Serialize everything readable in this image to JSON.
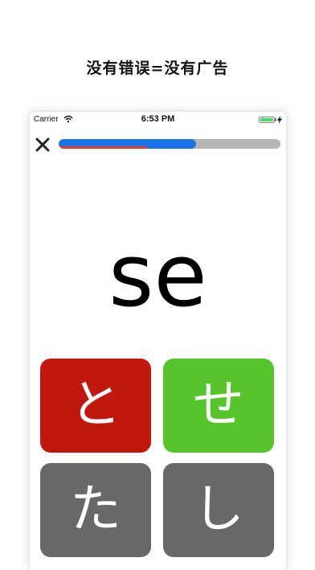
{
  "headline": "没有错误=没有广告",
  "statusbar": {
    "carrier": "Carrier",
    "time": "6:53 PM",
    "battery_color": "#4cd964"
  },
  "quiz": {
    "close_icon": "close-x-icon",
    "progress": {
      "fraction": 0.62,
      "error_fraction": 0.4,
      "fill_color": "#1a73e8",
      "error_color": "#e53935"
    },
    "prompt": "se",
    "answers": [
      {
        "kana": "と",
        "state": "wrong",
        "color": "#c0170f"
      },
      {
        "kana": "せ",
        "state": "correct",
        "color": "#56c42a"
      },
      {
        "kana": "た",
        "state": "neutral",
        "color": "#686868"
      },
      {
        "kana": "し",
        "state": "neutral",
        "color": "#686868"
      }
    ]
  }
}
